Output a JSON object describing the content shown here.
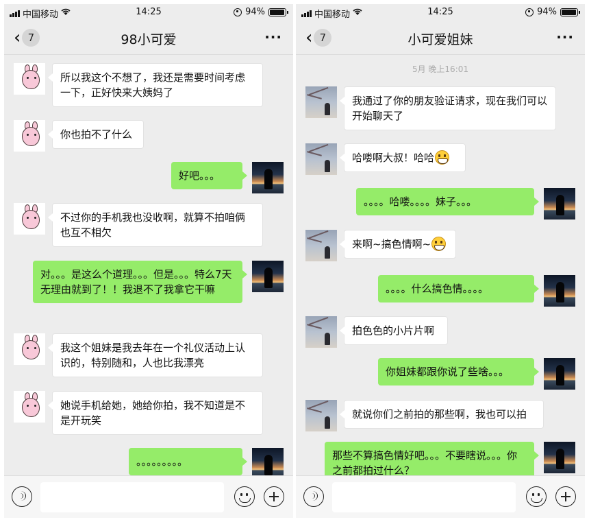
{
  "colors": {
    "chat_background": "#ededed",
    "outgoing_bubble": "#95ec69",
    "incoming_bubble": "#ffffff"
  },
  "left": {
    "status": {
      "carrier": "中国移动",
      "time": "14:25",
      "battery": "94%"
    },
    "nav": {
      "back_count": "7",
      "title": "98小可爱",
      "more_icon": "more-dots-icon"
    },
    "messages": [
      {
        "side": "in",
        "avatar": "pink-pig",
        "text": "所以我这个不想了，我还是需要时间考虑一下，正好快来大姨妈了"
      },
      {
        "side": "in",
        "avatar": "pink-pig",
        "text": "你也拍不了什么"
      },
      {
        "side": "out",
        "avatar": "sunset-silhouette",
        "text": "好吧。。。"
      },
      {
        "side": "in",
        "avatar": "pink-pig",
        "text": "不过你的手机我也没收啊，就算不拍咱俩也互不相欠"
      },
      {
        "side": "out",
        "avatar": "sunset-silhouette",
        "text": "对。。。是这么个道理。。。但是。。。特么7天无理由就到了！！我退不了我拿它干嘛"
      },
      {
        "side": "in",
        "avatar": "pink-pig",
        "text": "我这个姐妹是我去年在一个礼仪活动上认识的，特别随和，人也比我漂亮"
      },
      {
        "side": "in",
        "avatar": "pink-pig",
        "text": "她说手机给她，她给你拍，我不知道是不是开玩笑"
      },
      {
        "side": "out",
        "avatar": "sunset-silhouette",
        "text": "。。。。。。。。。"
      }
    ]
  },
  "right": {
    "status": {
      "carrier": "中国移动",
      "time": "14:25",
      "battery": "94%"
    },
    "nav": {
      "back_count": "7",
      "title": "小可爱姐妹",
      "more_icon": "more-dots-icon"
    },
    "timestamp": "5月 晚上16:01",
    "messages": [
      {
        "side": "in",
        "avatar": "tree-person",
        "text": "我通过了你的朋友验证请求，现在我们可以开始聊天了"
      },
      {
        "side": "in",
        "avatar": "tree-person",
        "text": "哈喽啊大叔！哈哈",
        "emoji": "grin-emoji"
      },
      {
        "side": "out",
        "avatar": "sunset-silhouette",
        "text": "。。。。哈喽。。。。妹子。。。"
      },
      {
        "side": "in",
        "avatar": "tree-person",
        "text": "来啊~搞色情啊~",
        "emoji": "grin-emoji"
      },
      {
        "side": "out",
        "avatar": "sunset-silhouette",
        "text": "。。。。什么搞色情。。。。"
      },
      {
        "side": "in",
        "avatar": "tree-person",
        "text": "拍色色的小片片啊"
      },
      {
        "side": "out",
        "avatar": "sunset-silhouette",
        "text": "你姐妹都跟你说了些啥。。。"
      },
      {
        "side": "in",
        "avatar": "tree-person",
        "text": "就说你们之前拍的那些啊，我也可以拍"
      },
      {
        "side": "out",
        "avatar": "sunset-silhouette",
        "text": "那些不算搞色情好吧。。。不要瞎说。。。你之前都拍过什么？"
      }
    ]
  },
  "inputbar": {
    "voice_icon": "voice-icon",
    "emoji_icon": "emoji-icon",
    "plus_icon": "plus-icon",
    "placeholder": ""
  }
}
